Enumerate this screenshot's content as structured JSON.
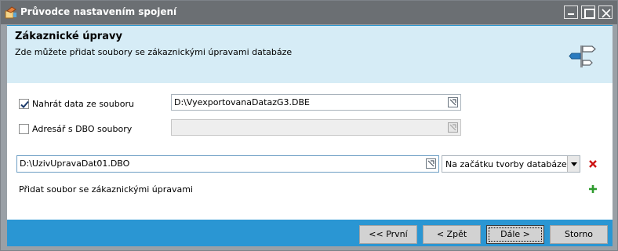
{
  "window": {
    "title": "Průvodce nastavením spojení"
  },
  "header": {
    "title": "Zákaznické úpravy",
    "subtitle": "Zde můžete přidat soubory se zákaznickými úpravami databáze"
  },
  "options": {
    "load_from_file": {
      "label": "Nahrát data ze souboru",
      "checked": true,
      "path": "D:\\VyexportovanaDatazG3.DBE"
    },
    "dbo_folder": {
      "label": "Adresář s DBO soubory",
      "checked": false,
      "path": ""
    }
  },
  "custom_file": {
    "path": "D:\\UzivUpravaDat01.DBO",
    "timing_selected": "Na začátku tvorby databáze"
  },
  "add_file_label": "Přidat soubor se zákaznickými úpravami",
  "buttons": {
    "first": "<< První",
    "back": "< Zpět",
    "next": "Dále >",
    "cancel": "Storno"
  },
  "colors": {
    "titlebar": "#6b6f73",
    "header_bg": "#d6ecf6",
    "footer_bg": "#2a96d3",
    "delete_red": "#cc1111",
    "add_green": "#2e9b2e"
  },
  "icons": {
    "app": "wizard-app-icon",
    "header": "signpost-icon",
    "browse": "browse-folder-icon",
    "delete": "delete-x-icon",
    "add": "add-plus-icon"
  }
}
